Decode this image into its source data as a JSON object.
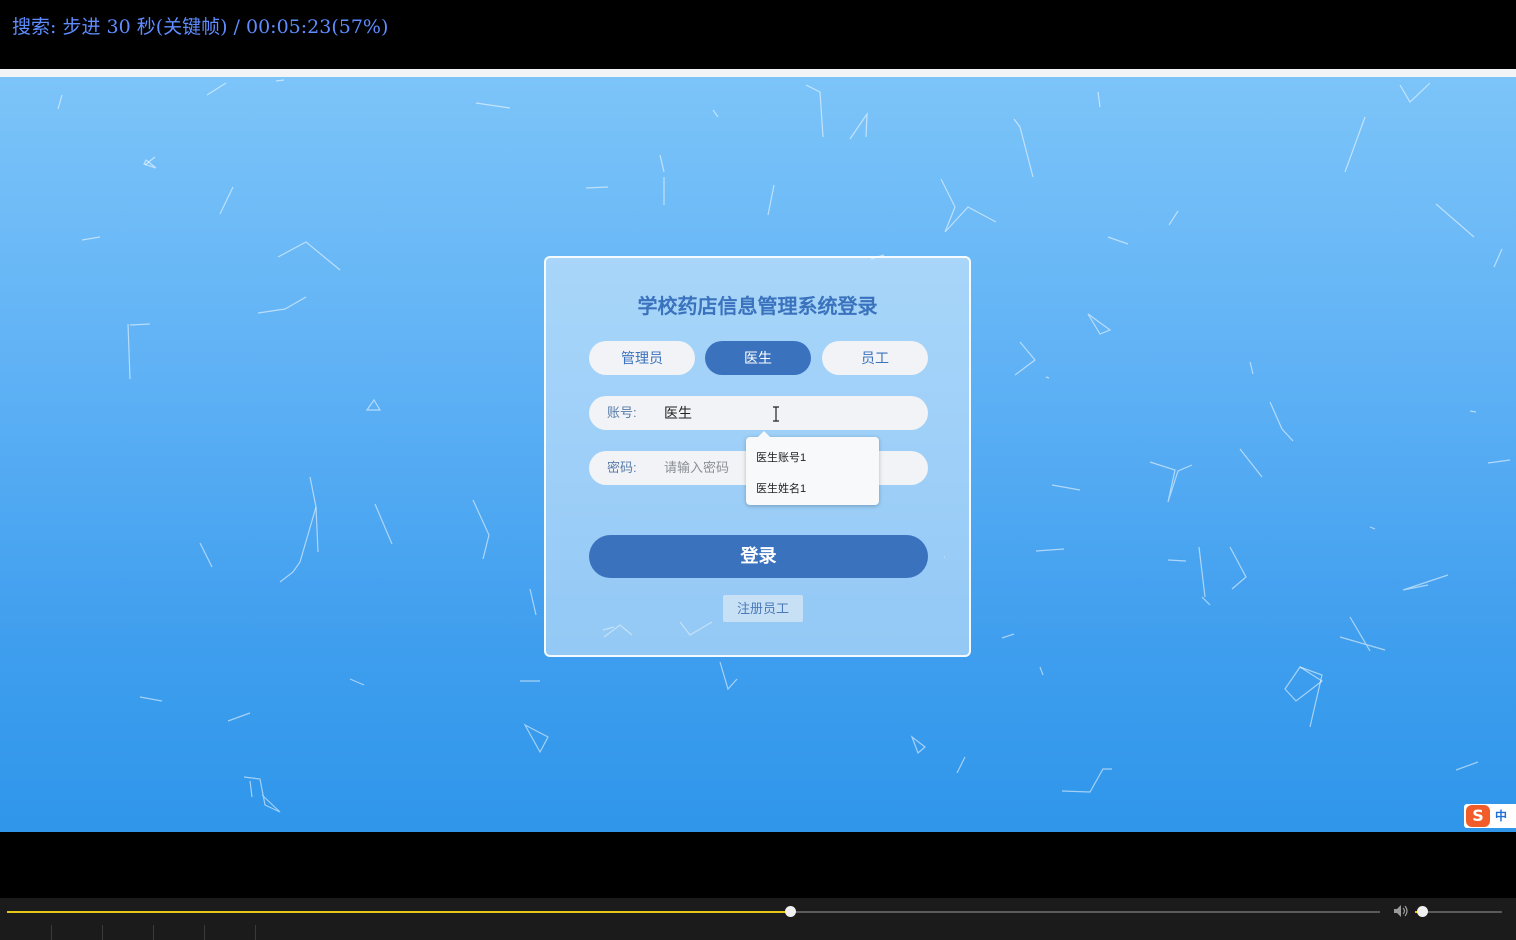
{
  "player": {
    "osd_text": "搜索: 步进 30 秒(关键帧) / 00:05:23(57%)",
    "seek_progress": 0.57,
    "volume_level": 0.08,
    "accent_color": "#e6c619"
  },
  "login": {
    "title": "学校药店信息管理系统登录",
    "roles": [
      {
        "label": "管理员",
        "active": false
      },
      {
        "label": "医生",
        "active": true
      },
      {
        "label": "员工",
        "active": false
      }
    ],
    "account_label": "账号:",
    "account_value": "医生",
    "password_label": "密码:",
    "password_placeholder": "请输入密码",
    "autocomplete": [
      "医生账号1",
      "医生姓名1"
    ],
    "login_button": "登录",
    "register_link": "注册员工",
    "brand_color": "#3a72bd"
  },
  "ime": {
    "logo": "S",
    "language": "中"
  }
}
